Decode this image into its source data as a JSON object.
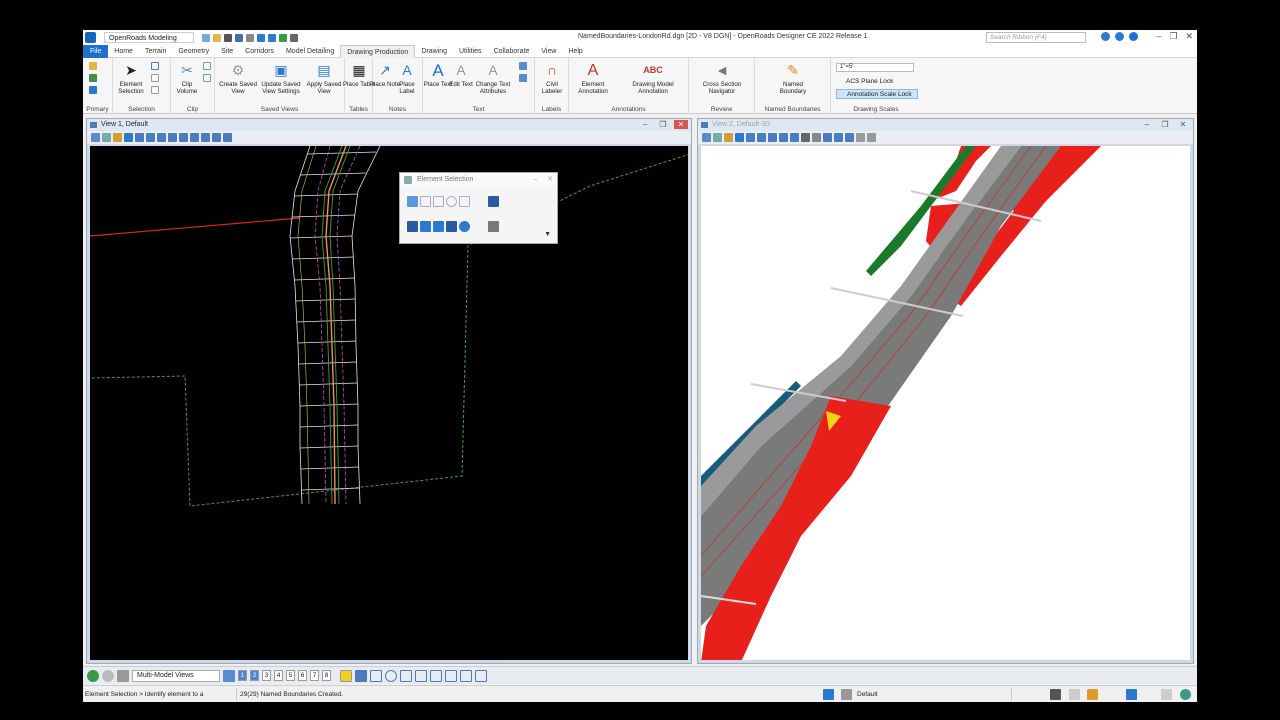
{
  "titlebar": {
    "workflow": "OpenRoads Modeling",
    "title": "NamedBoundaries-LondonRd.dgn [2D - V8 DGN] - OpenRoads Designer CE 2022 Release 1",
    "search_placeholder": "Search Ribbon (F4)"
  },
  "tabs": [
    "File",
    "Home",
    "Terrain",
    "Geometry",
    "Site",
    "Corridors",
    "Model Detailing",
    "Drawing Production",
    "Drawing",
    "Utilities",
    "Collaborate",
    "View",
    "Help"
  ],
  "active_tab": "Drawing Production",
  "ribbon": {
    "groups": {
      "primary": "Primary",
      "selection": "Selection",
      "clip": "Clip",
      "saved_views": "Saved Views",
      "tables": "Tables",
      "notes": "Notes",
      "text": "Text",
      "labels": "Labels",
      "annotations": "Annotations",
      "review": "Review",
      "named_boundaries": "Named Boundaries",
      "drawing_scales": "Drawing Scales"
    },
    "buttons": {
      "element_selection": "Element Selection",
      "clip_volume": "Clip Volume",
      "create_saved_view": "Create Saved View",
      "update_saved_view_settings": "Update Saved View Settings",
      "apply_saved_view": "Apply Saved View",
      "place_table": "Place Table",
      "place_note": "Place Note",
      "place_label": "Place Label",
      "place_text": "Place Text",
      "edit_text": "Edit Text",
      "change_text_attributes": "Change Text Attributes",
      "civil_labeler": "Civil Labeler",
      "element_annotation": "Element Annotation",
      "drawing_model_annotation": "Drawing Model Annotation",
      "cross_section_navigator": "Cross Section Navigator",
      "named_boundary": "Named Boundary"
    },
    "drawing_scale": {
      "value": "1\"=5'",
      "acs_plane_lock": "ACS Plane Lock",
      "annotation_scale_lock": "Annotation Scale Lock"
    }
  },
  "views": {
    "view1_title": "View 1, Default",
    "view2_title": "View 2, Default-3D"
  },
  "element_selection_dialog": {
    "title": "Element Selection"
  },
  "bottombar": {
    "multi_model_views": "Multi-Model Views",
    "view_numbers": [
      "1",
      "2",
      "3",
      "4",
      "5",
      "6",
      "7",
      "8"
    ]
  },
  "status": {
    "prompt": "Element Selection > Identify element to a",
    "message": "29(29) Named Boundaries Created.",
    "level": "Default"
  },
  "colors": {
    "file_tab": "#1e6fd0",
    "canvas_2d": "#000000",
    "canvas_3d": "#ffffff",
    "slope_red": "#e8201c",
    "slope_yellow": "#f2d21a",
    "road_gray": "#7a7a7a"
  }
}
